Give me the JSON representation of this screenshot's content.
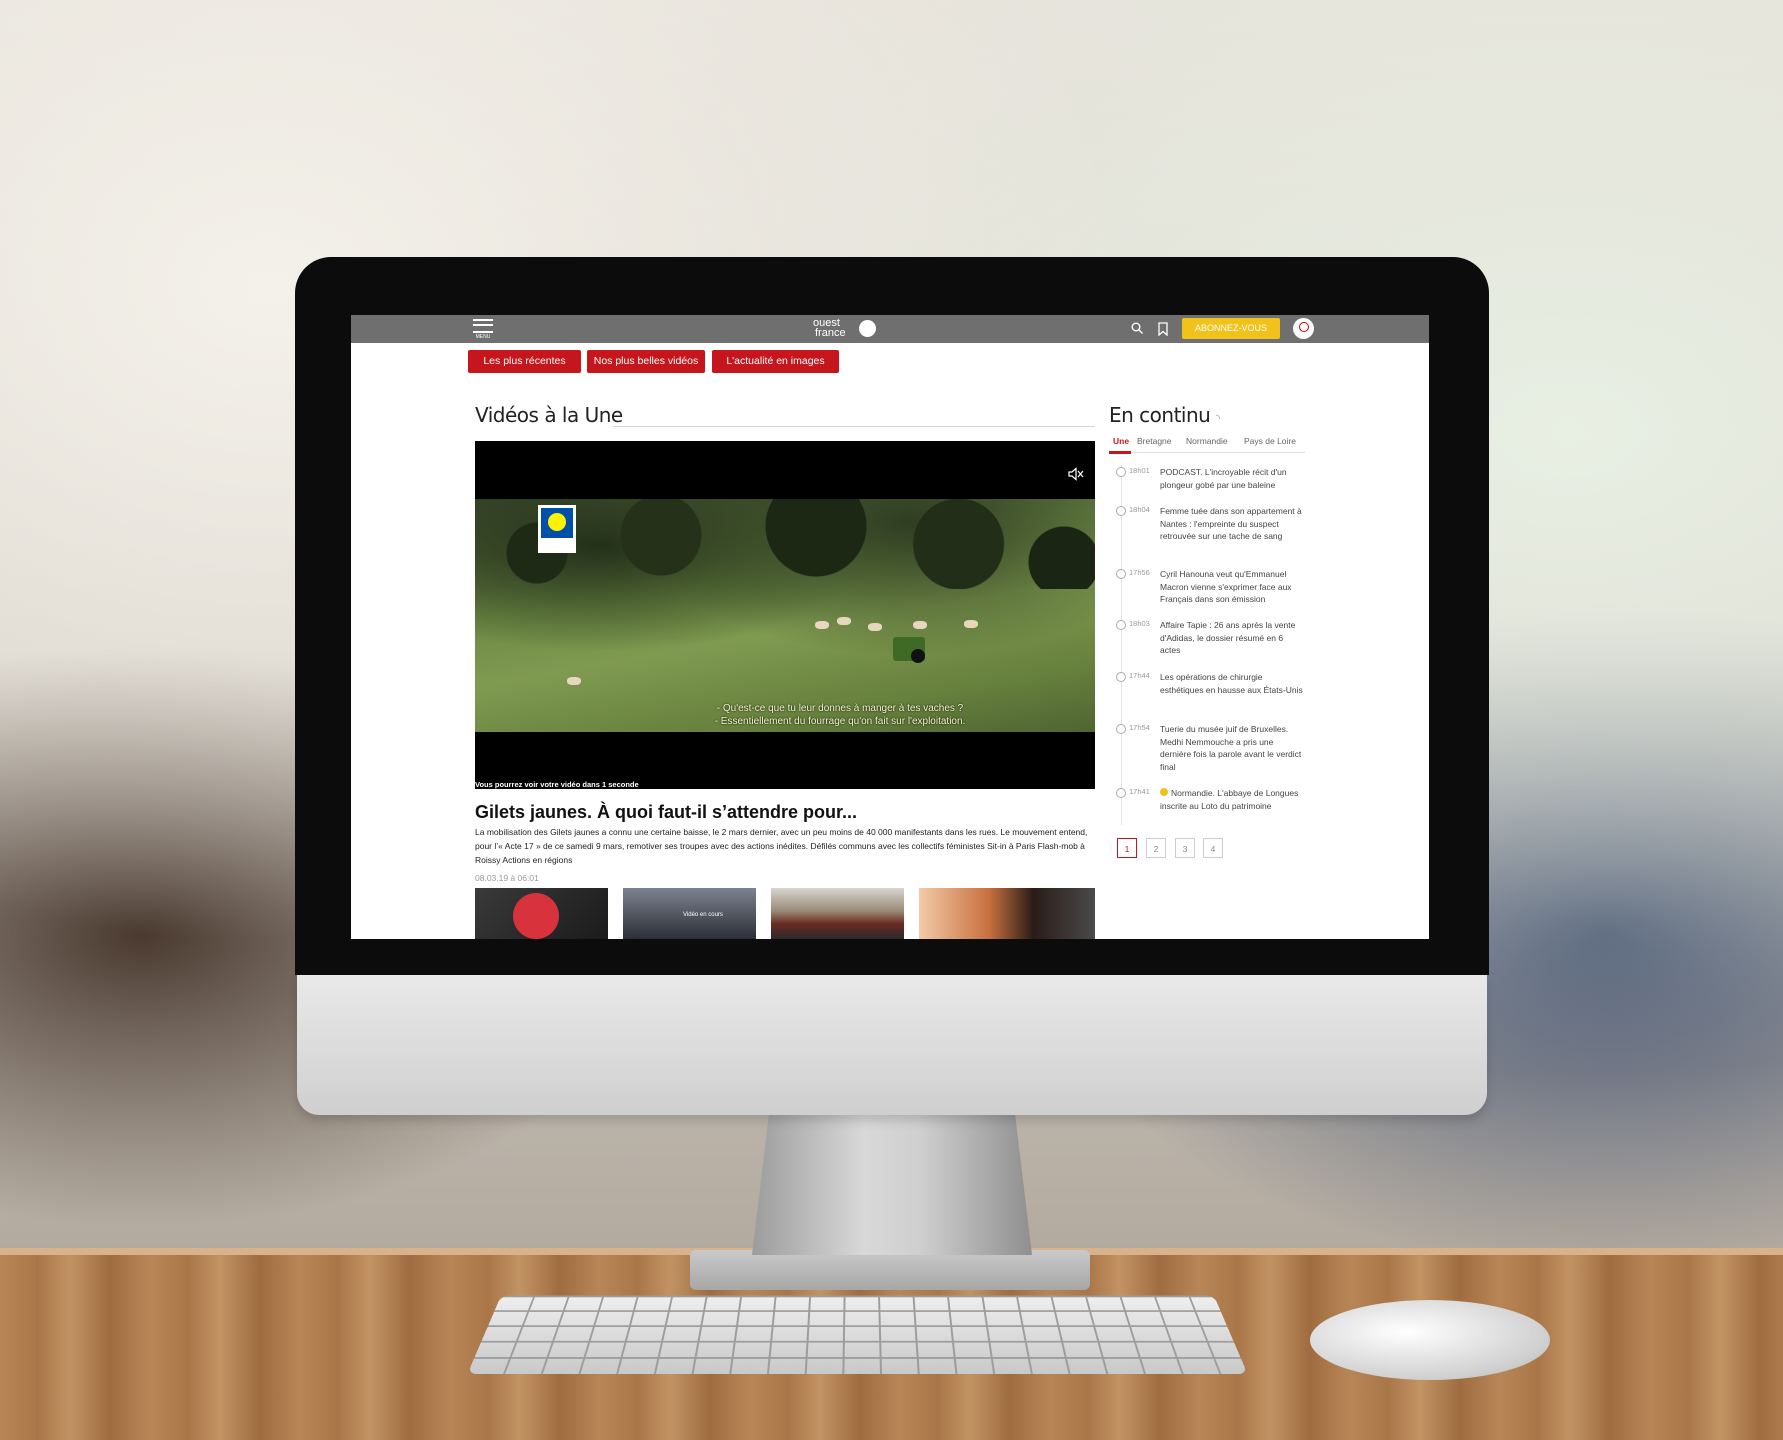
{
  "header": {
    "menu_label": "MENU",
    "logo_line1": "ouest",
    "logo_line2": "france",
    "subscribe_label": "ABONNEZ-VOUS"
  },
  "nav_tabs": [
    {
      "label": "Les plus récentes"
    },
    {
      "label": "Nos plus belles vidéos"
    },
    {
      "label": "L'actualité en images"
    }
  ],
  "main": {
    "section_title": "Vidéos à la Une",
    "video": {
      "subtitle_line1": "- Qu'est-ce que tu leur donnes à manger à tes vaches ?",
      "subtitle_line2": "- Essentiellement du fourrage qu'on fait sur l'exploitation.",
      "note": "Vous pourrez voir votre vidéo dans 1 seconde",
      "brand": "LIDL"
    },
    "headline": "Gilets jaunes. À quoi faut-il s’attendre pour...",
    "summary": "La mobilisation des Gilets jaunes a connu une certaine baisse, le 2 mars dernier, avec un peu moins de 40 000 manifestants dans les rues. Le mouvement entend, pour l’« Acte 17 » de ce samedi 9 mars, remotiver ses troupes avec des actions inédites. Défilés communs avec les collectifs féministes Sit-in à Paris Flash-mob à Roissy Actions en régions",
    "date": "08.03.19 à 06:01",
    "thumbnail_loading": "Vidéo en cours"
  },
  "sidebar": {
    "title": "En continu",
    "region_tabs": [
      "Une",
      "Bretagne",
      "Normandie",
      "Pays de Loire"
    ],
    "news": [
      {
        "time": "18h01",
        "text": "PODCAST. L'incroyable récit d'un plongeur gobé par une baleine"
      },
      {
        "time": "18h04",
        "text": "Femme tuée dans son appartement à Nantes : l'empreinte du suspect retrouvée sur une tache de sang"
      },
      {
        "time": "17h56",
        "text": "Cyril Hanouna veut qu'Emmanuel Macron vienne s'exprimer face aux Français dans son émission"
      },
      {
        "time": "18h03",
        "text": "Affaire Tapie : 26 ans après la vente d'Adidas, le dossier résumé en 6 actes"
      },
      {
        "time": "17h44",
        "text": "Les opérations de chirurgie esthétiques en hausse aux États-Unis"
      },
      {
        "time": "17h54",
        "text": "Tuerie du musée juif de Bruxelles. Medhi Nemmouche a pris une dernière fois la parole avant le verdict final"
      },
      {
        "time": "17h41",
        "text": "Normandie. L'abbaye de Longues inscrite au Loto du patrimoine"
      }
    ],
    "pages": [
      "1",
      "2",
      "3",
      "4"
    ]
  },
  "colors": {
    "accent_red": "#c5161d",
    "topbar_gray": "#6f6f6f",
    "subscribe_yellow": "#f2c21c"
  }
}
